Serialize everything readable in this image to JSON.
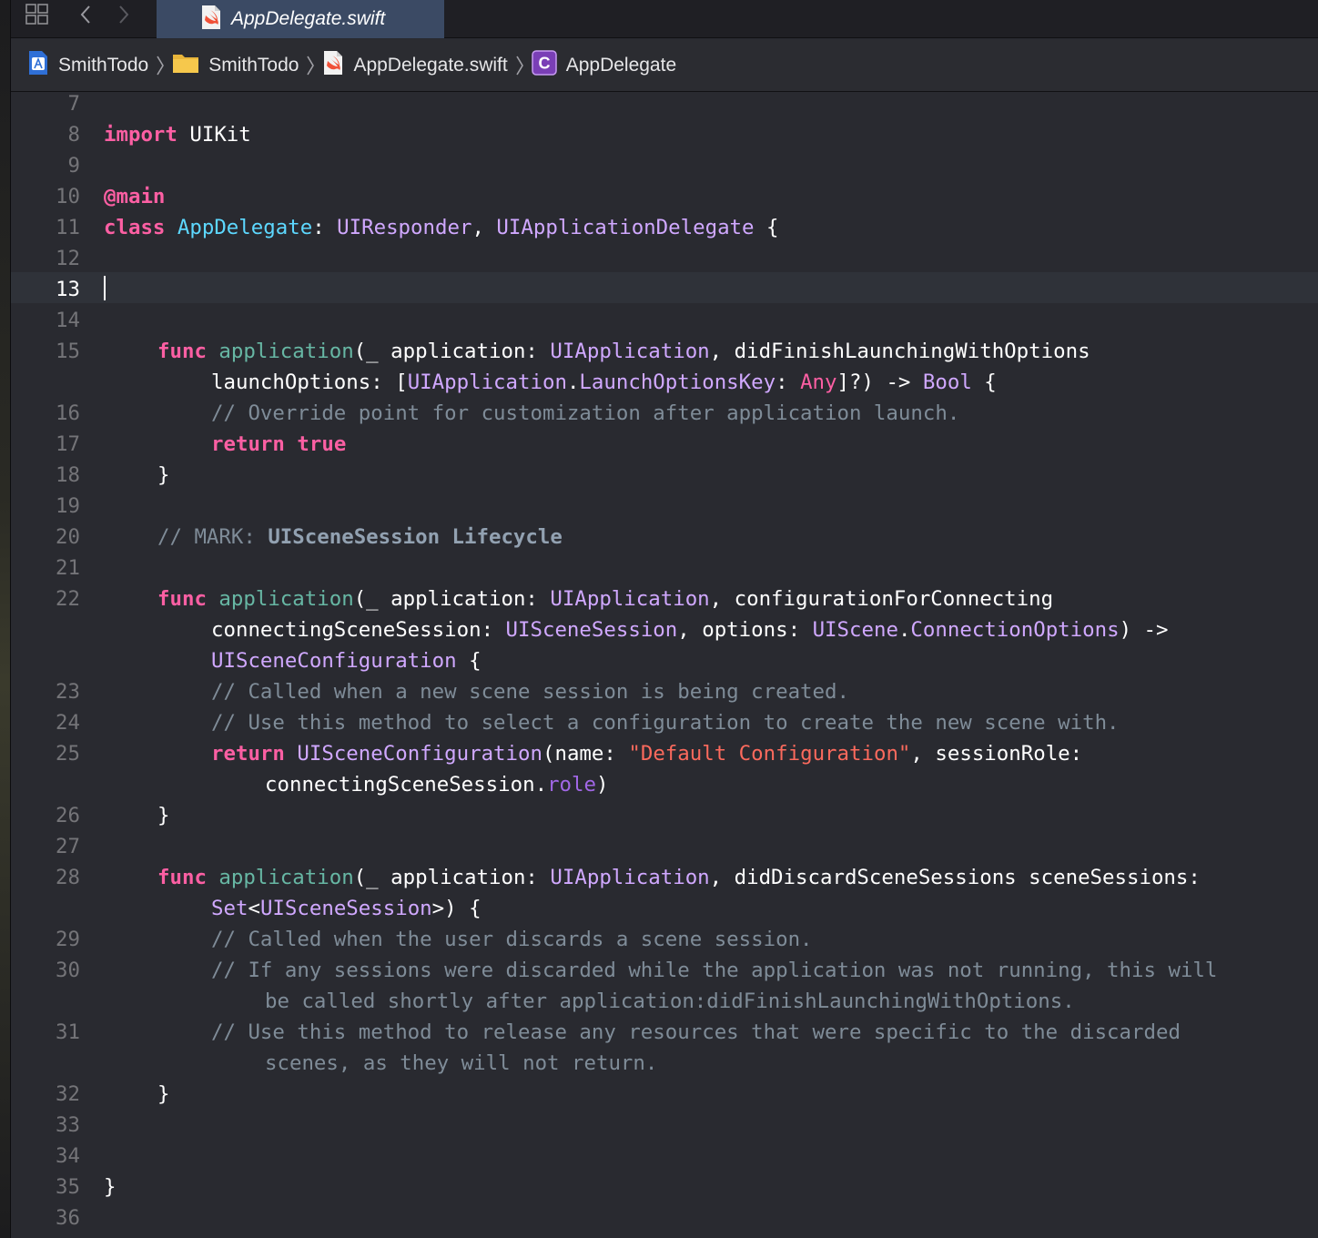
{
  "tab": {
    "title": "AppDelegate.swift"
  },
  "breadcrumbs": [
    {
      "label": "SmithTodo",
      "icon": "xcode-project-icon"
    },
    {
      "label": "SmithTodo",
      "icon": "folder-icon"
    },
    {
      "label": "AppDelegate.swift",
      "icon": "swift-file-icon"
    },
    {
      "label": "AppDelegate",
      "icon": "class-icon",
      "icon_letter": "C"
    }
  ],
  "editor": {
    "current_line": "13",
    "line_numbers": [
      "7",
      "8",
      "9",
      "10",
      "11",
      "12",
      "13",
      "14",
      "15",
      "16",
      "17",
      "18",
      "19",
      "20",
      "21",
      "22",
      "23",
      "24",
      "25",
      "26",
      "27",
      "28",
      "29",
      "30",
      "31",
      "32",
      "33",
      "34",
      "35",
      "36"
    ],
    "code": {
      "l8_kw": "import",
      "l8_rest": " UIKit",
      "l10": "@main",
      "l11_kw": "class",
      "l11_name": "AppDelegate",
      "l11_colon": ": ",
      "l11_t1": "UIResponder",
      "l11_comma": ", ",
      "l11_t2": "UIApplicationDelegate",
      "l11_brace": " {",
      "l15_kw": "func",
      "l15_fn": "application",
      "l15_paren": "(_",
      "l15_a": " application: ",
      "l15_t": "UIApplication",
      "l15_b": ", didFinishLaunchingWithOptions",
      "l15b_a": "launchOptions: [",
      "l15b_t1": "UIApplication",
      "l15b_dot": ".",
      "l15b_t2": "LaunchOptionsKey",
      "l15b_c": ": ",
      "l15b_any": "Any",
      "l15b_d": "]?) -> ",
      "l15b_bool": "Bool",
      "l15b_e": " {",
      "l16": "// Override point for customization after application launch.",
      "l17_kw": "return",
      "l17_val": "true",
      "l18": "}",
      "l20_cm": "// MARK: ",
      "l20_mk": "UISceneSession Lifecycle",
      "l22_kw": "func",
      "l22_fn": "application",
      "l22_paren": "(_",
      "l22_a": " application: ",
      "l22_t": "UIApplication",
      "l22_b": ", configurationForConnecting",
      "l22b_a": "connectingSceneSession: ",
      "l22b_t1": "UISceneSession",
      "l22b_b": ", options: ",
      "l22b_t2": "UIScene",
      "l22b_dot": ".",
      "l22b_t3": "ConnectionOptions",
      "l22b_c": ") ->",
      "l22c_t": "UISceneConfiguration",
      "l22c_b": " {",
      "l23": "// Called when a new scene session is being created.",
      "l24": "// Use this method to select a configuration to create the new scene with.",
      "l25_kw": "return",
      "l25_t": "UISceneConfiguration",
      "l25_a": "(name: ",
      "l25_str": "\"Default Configuration\"",
      "l25_b": ", sessionRole:",
      "l25b_a": "connectingSceneSession.",
      "l25b_pr": "role",
      "l25b_b": ")",
      "l26": "}",
      "l28_kw": "func",
      "l28_fn": "application",
      "l28_paren": "(_",
      "l28_a": " application: ",
      "l28_t": "UIApplication",
      "l28_b": ", didDiscardSceneSessions sceneSessions:",
      "l28b_t1": "Set",
      "l28b_a": "<",
      "l28b_t2": "UISceneSession",
      "l28b_b": ">) {",
      "l29": "// Called when the user discards a scene session.",
      "l30": "// If any sessions were discarded while the application was not running, this will",
      "l30b": "be called shortly after application:didFinishLaunchingWithOptions.",
      "l31": "// Use this method to release any resources that were specific to the discarded",
      "l31b": "scenes, as they will not return.",
      "l32": "}",
      "l35": "}"
    }
  },
  "colors": {
    "background": "#292a30",
    "keyword": "#fc5fa3",
    "type": "#d0a8ff",
    "class_name": "#5dd8ff",
    "function": "#67b7a4",
    "comment": "#7f8c98",
    "string": "#fc6a5d",
    "active_tab": "#3b4a64"
  }
}
